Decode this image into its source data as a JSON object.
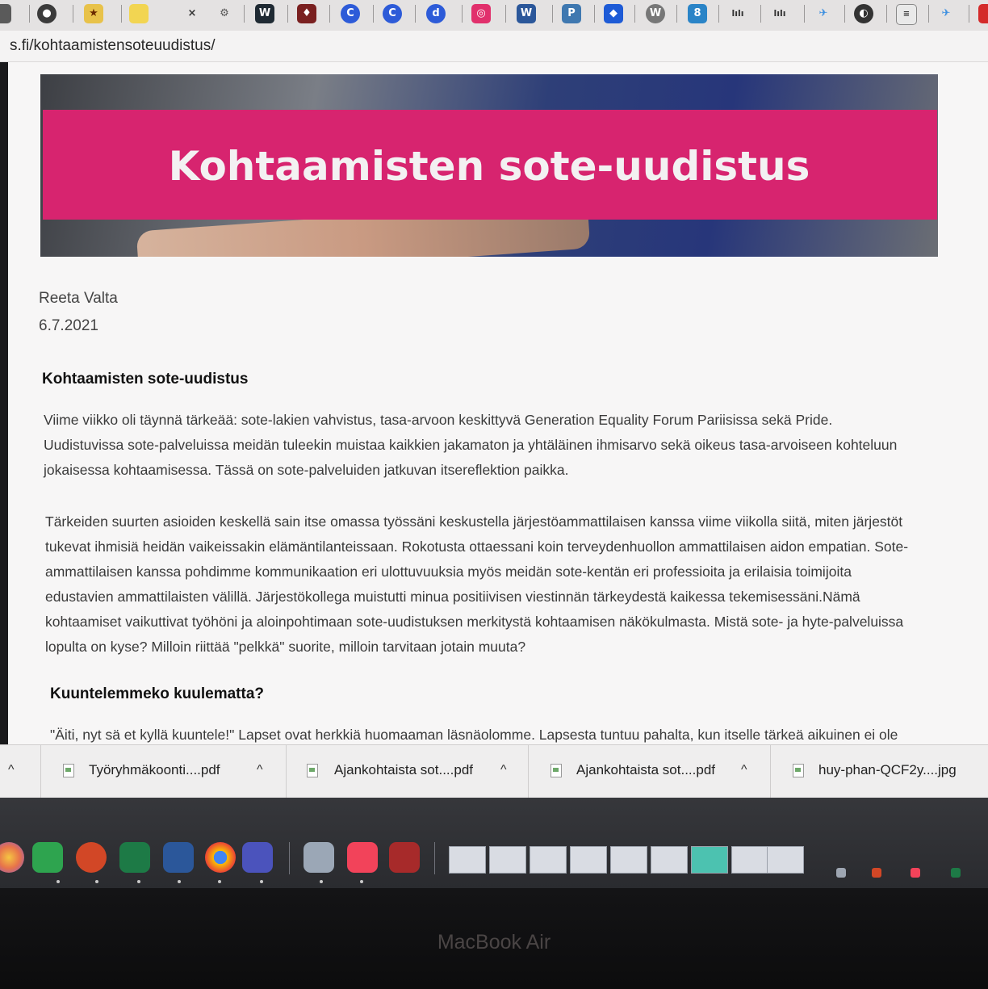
{
  "browser": {
    "url": "s.fi/kohtaamistensoteuudistus/"
  },
  "article": {
    "hero_title": "Kohtaamisten sote-uudistus",
    "author": "Reeta Valta",
    "date": "6.7.2021",
    "heading": "Kohtaamisten sote-uudistus",
    "para1": [
      "Viime viikko oli täynnä tärkeää: sote-lakien vahvistus, tasa-arvoon keskittyvä Generation Equality Forum Pariisissa sekä Pride.",
      "Uudistuvissa sote-palveluissa meidän tuleekin muistaa kaikkien jakamaton ja yhtäläinen ihmisarvo sekä oikeus tasa-arvoiseen kohteluun",
      "jokaisessa kohtaamisessa. Tässä on sote-palveluiden jatkuvan itsereflektion paikka."
    ],
    "para2": [
      "Tärkeiden suurten asioiden keskellä sain itse omassa työssäni keskustella järjestöammattilaisen kanssa viime viikolla siitä, miten järjestöt",
      "tukevat ihmisiä heidän vaikeissakin elämäntilanteissaan. Rokotusta ottaessani koin terveydenhuollon ammattilaisen aidon empatian. Sote-",
      "ammattilaisen kanssa pohdimme kommunikaation eri ulottuvuuksia myös meidän sote-kentän eri professioita ja erilaisia toimijoita",
      "edustavien ammattilaisten välillä. Järjestökollega muistutti minua positiivisen viestinnän tärkeydestä kaikessa tekemisessäni.Nämä",
      "kohtaamiset vaikuttivat työhöni ja aloinpohtimaan sote-uudistuksen merkitystä kohtaamisen näkökulmasta. Mistä sote- ja hyte-palveluissa",
      "lopulta on kyse? Milloin riittää \"pelkkä\" suorite, milloin tarvitaan jotain muuta?"
    ],
    "subheading": "Kuuntelemmeko kuulematta?",
    "para3_partial": "\"Äiti, nyt sä et kyllä kuuntele!\" Lapset ovat herkkiä huomaaman läsnäolomme. Lapsesta tuntuu pahalta, kun itselle tärkeä aikuinen ei ole"
  },
  "downloads": [
    {
      "name": "Työryhmäkoonti....pdf"
    },
    {
      "name": "Ajankohtaista sot....pdf"
    },
    {
      "name": "Ajankohtaista sot....pdf"
    },
    {
      "name": "huy-phan-QCF2y....jpg"
    }
  ],
  "bookmarks_icons": [
    "generic-icon",
    "favorite-icon",
    "folder-icon",
    "x-icon",
    "globe-icon",
    "w-icon",
    "game-icon",
    "c-icon",
    "c-icon",
    "d-icon",
    "instagram-icon",
    "word-icon",
    "python-icon",
    "dropbox-icon",
    "wordpress-icon",
    "app-icon",
    "bars-icon",
    "bars-icon",
    "plane-icon",
    "globe-icon",
    "list-icon",
    "plane-icon",
    "red-icon"
  ],
  "dock_apps": [
    "photos-icon",
    "numbers-icon",
    "powerpoint-icon",
    "excel-icon",
    "word-icon",
    "chrome-icon",
    "teams-icon",
    "preview-icon",
    "music-icon",
    "dictionary-icon"
  ],
  "macbook_label": "MacBook Air",
  "colors": {
    "hero_band": "#d7246f",
    "page_bg": "#f7f6f6"
  }
}
